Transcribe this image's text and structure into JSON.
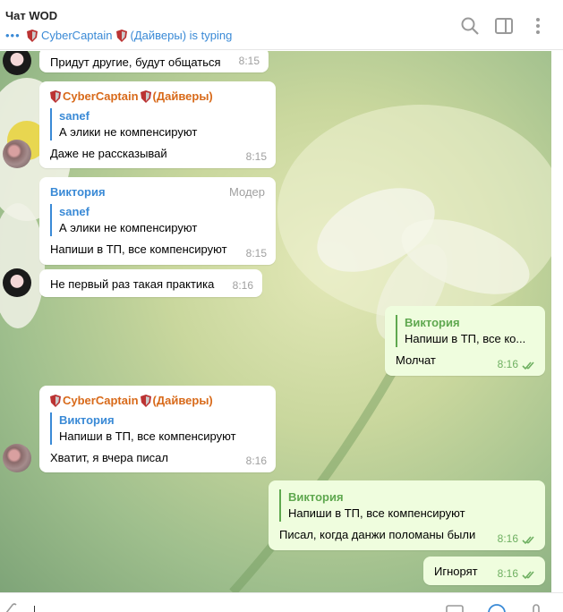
{
  "header": {
    "title": "Чат WOD",
    "typing_user": "CyberCaptain",
    "typing_suffix": "(Дайверы) is typing"
  },
  "messages": [
    {
      "text": "Придут другие, будут общаться",
      "time": "8:15"
    },
    {
      "sender": "CyberCaptain",
      "sender_suffix": "(Дайверы)",
      "quote_name": "sanef",
      "quote_text": "А элики не компенсируют",
      "text": "Даже не рассказывай",
      "time": "8:15"
    },
    {
      "sender": "Виктория",
      "role": "Модер",
      "quote_name": "sanef",
      "quote_text": "А элики не компенсируют",
      "text": "Напиши в ТП, все компенсируют",
      "time": "8:15"
    },
    {
      "text": "Не первый раз такая практика",
      "time": "8:16"
    },
    {
      "quote_name": "Виктория",
      "quote_text": "Напиши в ТП, все ко...",
      "text": "Молчат",
      "time": "8:16"
    },
    {
      "sender": "CyberCaptain",
      "sender_suffix": "(Дайверы)",
      "quote_name": "Виктория",
      "quote_text": "Напиши в ТП, все компенсируют",
      "text": "Хватит, я вчера писал",
      "time": "8:16"
    },
    {
      "quote_name": "Виктория",
      "quote_text": "Напиши в ТП, все компенсируют",
      "text": "Писал, когда данжи поломаны были",
      "time": "8:16"
    },
    {
      "text": "Игнорят",
      "time": "8:16"
    }
  ],
  "colors": {
    "accent": "#3a8ad6",
    "sender": "#d86a1a",
    "outgoing": "#effdde",
    "read_ticks": "#6fb062"
  },
  "icons": [
    "search-icon",
    "sidebar-toggle-icon",
    "more-vert-icon",
    "shield-icon",
    "double-check-icon",
    "attach-icon",
    "emoji-icon",
    "mic-icon"
  ]
}
